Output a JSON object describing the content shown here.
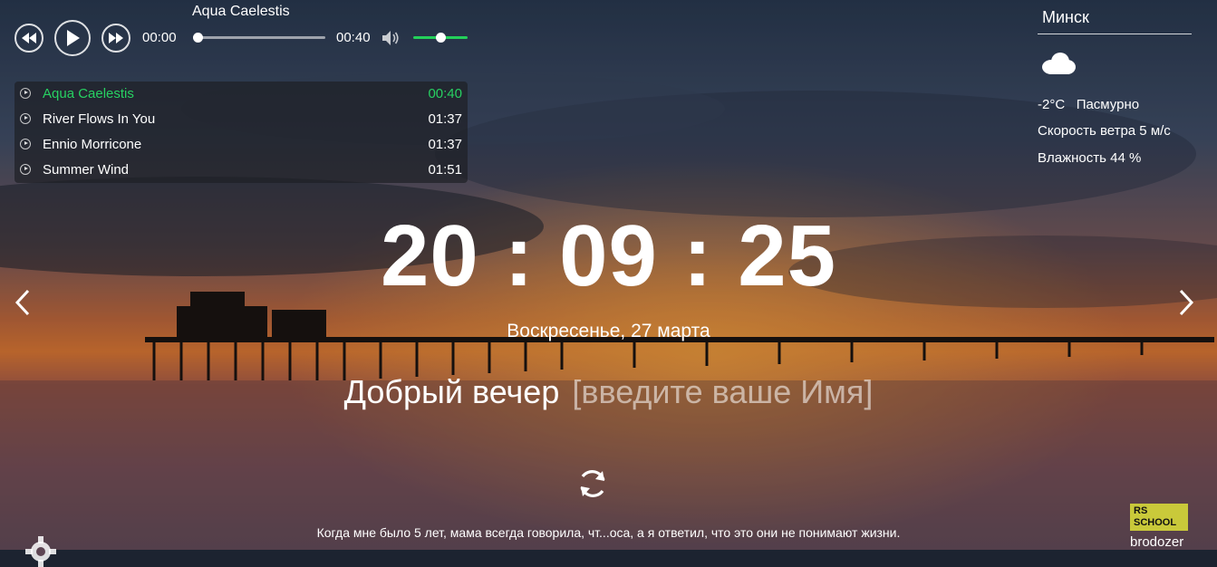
{
  "player": {
    "current_title": "Aqua Caelestis",
    "time_current": "00:00",
    "time_total": "00:40",
    "progress_fraction": 0.0,
    "volume_fraction": 0.5
  },
  "playlist": [
    {
      "name": "Aqua Caelestis",
      "duration": "00:40",
      "active": true
    },
    {
      "name": "River Flows In You",
      "duration": "01:37",
      "active": false
    },
    {
      "name": "Ennio Morricone",
      "duration": "01:37",
      "active": false
    },
    {
      "name": "Summer Wind",
      "duration": "01:51",
      "active": false
    }
  ],
  "weather": {
    "city": "Минск",
    "icon": "cloud-icon",
    "temp": "-2°C",
    "description": "Пасмурно",
    "wind": "Скорость ветра 5 м/с",
    "humidity": "Влажность 44 %"
  },
  "clock": {
    "time": "20 : 09 : 25"
  },
  "date": "Воскресенье, 27 марта",
  "greeting": {
    "text": "Добрый вечер",
    "name_placeholder": "[введите ваше Имя]"
  },
  "quote": "Когда мне было 5 лет, мама всегда говорила, чт...оса, а я ответил, что это они не понимают жизни.",
  "footer": {
    "author": "brodozer",
    "logo_text": "RS SCHOOL"
  },
  "colors": {
    "accent_green": "#27d162",
    "volume_green": "#23d15a",
    "logo_yellow": "#c9c93a"
  }
}
